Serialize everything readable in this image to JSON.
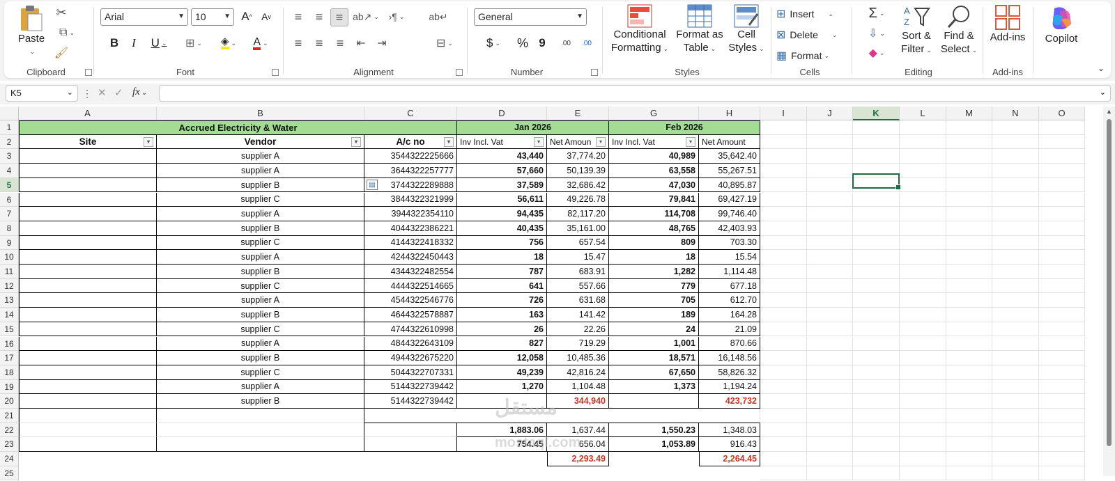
{
  "ribbon": {
    "clipboard": {
      "label": "Clipboard",
      "paste": "Paste"
    },
    "font": {
      "label": "Font",
      "family": "Arial",
      "size": "10",
      "grow": "A",
      "shrink": "A",
      "bold": "B",
      "italic": "I",
      "underline": "U",
      "font_color_letter": "A"
    },
    "alignment": {
      "label": "Alignment"
    },
    "number": {
      "label": "Number",
      "format": "General",
      "currency": "$",
      "percent": "%",
      "comma": "9",
      "inc_dec": ".00",
      "dec_dec": ".00"
    },
    "styles": {
      "label": "Styles",
      "conditional_1": "Conditional",
      "conditional_2": "Formatting",
      "format_table_1": "Format as",
      "format_table_2": "Table",
      "cell_styles_1": "Cell",
      "cell_styles_2": "Styles"
    },
    "cells": {
      "label": "Cells",
      "insert": "Insert",
      "delete": "Delete",
      "format": "Format"
    },
    "editing": {
      "label": "Editing",
      "sort_1": "Sort &",
      "sort_2": "Filter",
      "find_1": "Find &",
      "find_2": "Select"
    },
    "addins": {
      "label": "Add-ins",
      "addins": "Add-ins"
    },
    "copilot": {
      "label": "Copilot"
    }
  },
  "formula_bar": {
    "name_box": "K5",
    "fx": "fx",
    "value": ""
  },
  "columns": [
    "A",
    "B",
    "C",
    "D",
    "E",
    "G",
    "H",
    "I",
    "J",
    "K",
    "L",
    "M",
    "N",
    "O"
  ],
  "rows": [
    "1",
    "2",
    "3",
    "4",
    "5",
    "6",
    "7",
    "8",
    "9",
    "10",
    "11",
    "12",
    "13",
    "14",
    "15",
    "16",
    "17",
    "18",
    "19",
    "20",
    "21",
    "22",
    "23",
    "24",
    "25"
  ],
  "table": {
    "title": "Accrued Electricity & Water",
    "month1": "Jan 2026",
    "month2": "Feb 2026",
    "headers": {
      "site": "Site",
      "vendor": "Vendor",
      "acno": "A/c no",
      "inv1": "Inv Incl. Vat",
      "net1": "Net Amoun",
      "inv2": "Inv Incl. Vat",
      "net2": "Net Amount"
    },
    "data": [
      [
        "supplier A",
        "3544322225666",
        "43,440",
        "37,774.20",
        "40,989",
        "35,642.40"
      ],
      [
        "supplier A",
        "3644322257777",
        "57,660",
        "50,139.39",
        "63,558",
        "55,267.51"
      ],
      [
        "supplier B",
        "3744322289888",
        "37,589",
        "32,686.42",
        "47,030",
        "40,895.87"
      ],
      [
        "supplier C",
        "3844322321999",
        "56,611",
        "49,226.78",
        "79,841",
        "69,427.19"
      ],
      [
        "supplier A",
        "3944322354110",
        "94,435",
        "82,117.20",
        "114,708",
        "99,746.40"
      ],
      [
        "supplier B",
        "4044322386221",
        "40,435",
        "35,161.00",
        "48,765",
        "42,403.93"
      ],
      [
        "supplier C",
        "4144322418332",
        "756",
        "657.54",
        "809",
        "703.30"
      ],
      [
        "supplier A",
        "4244322450443",
        "18",
        "15.47",
        "18",
        "15.54"
      ],
      [
        "supplier B",
        "4344322482554",
        "787",
        "683.91",
        "1,282",
        "1,114.48"
      ],
      [
        "supplier C",
        "4444322514665",
        "641",
        "557.66",
        "779",
        "677.18"
      ],
      [
        "supplier A",
        "4544322546776",
        "726",
        "631.68",
        "705",
        "612.70"
      ],
      [
        "supplier B",
        "4644322578887",
        "163",
        "141.42",
        "189",
        "164.28"
      ],
      [
        "supplier C",
        "4744322610998",
        "26",
        "22.26",
        "24",
        "21.09"
      ],
      [
        "supplier A",
        "4844322643109",
        "827",
        "719.29",
        "1,001",
        "870.66"
      ],
      [
        "supplier B",
        "4944322675220",
        "12,058",
        "10,485.36",
        "18,571",
        "16,148.56"
      ],
      [
        "supplier C",
        "5044322707331",
        "49,239",
        "42,816.24",
        "67,650",
        "58,826.32"
      ],
      [
        "supplier A",
        "5144322739442",
        "1,270",
        "1,104.48",
        "1,373",
        "1,194.24"
      ],
      [
        "supplier B",
        "5144322739442",
        "",
        "344,940",
        "",
        "423,732"
      ]
    ],
    "sum22": [
      "1,883.06",
      "1,637.44",
      "1,550.23",
      "1,348.03"
    ],
    "sum23": [
      "754.45",
      "656.04",
      "1,053.89",
      "916.43"
    ],
    "sum24": [
      "2,293.49",
      "2,264.45"
    ]
  },
  "watermark": {
    "ar": "مستقل",
    "en": "mostaql.com"
  }
}
